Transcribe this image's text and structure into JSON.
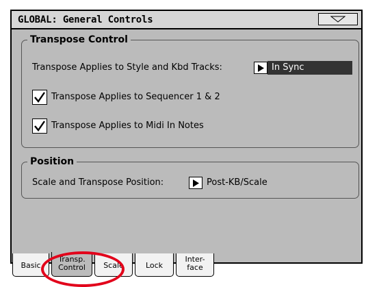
{
  "window": {
    "title": "GLOBAL: General Controls",
    "menu_icon": "triangle-down-icon"
  },
  "transpose_control": {
    "label": "Transpose Control",
    "style_kbd_label": "Transpose Applies to Style and Kbd Tracks:",
    "style_kbd_value": "In Sync",
    "sequencer_label": "Transpose Applies to Sequencer 1 & 2",
    "sequencer_checked": true,
    "midi_in_label": "Transpose Applies to Midi In Notes",
    "midi_in_checked": true
  },
  "position": {
    "label": "Position",
    "scale_label": "Scale and Transpose Position:",
    "scale_value": "Post-KB/Scale"
  },
  "tabs": [
    {
      "label": "Basic"
    },
    {
      "label_line1": "Transp.",
      "label_line2": "Control",
      "active": true
    },
    {
      "label": "Scale"
    },
    {
      "label": "Lock"
    },
    {
      "label_line1": "Inter-",
      "label_line2": "face"
    }
  ],
  "colors": {
    "highlight_circle": "#e2001a",
    "panel_bg": "#bbbbbb",
    "value_bg": "#333333"
  }
}
